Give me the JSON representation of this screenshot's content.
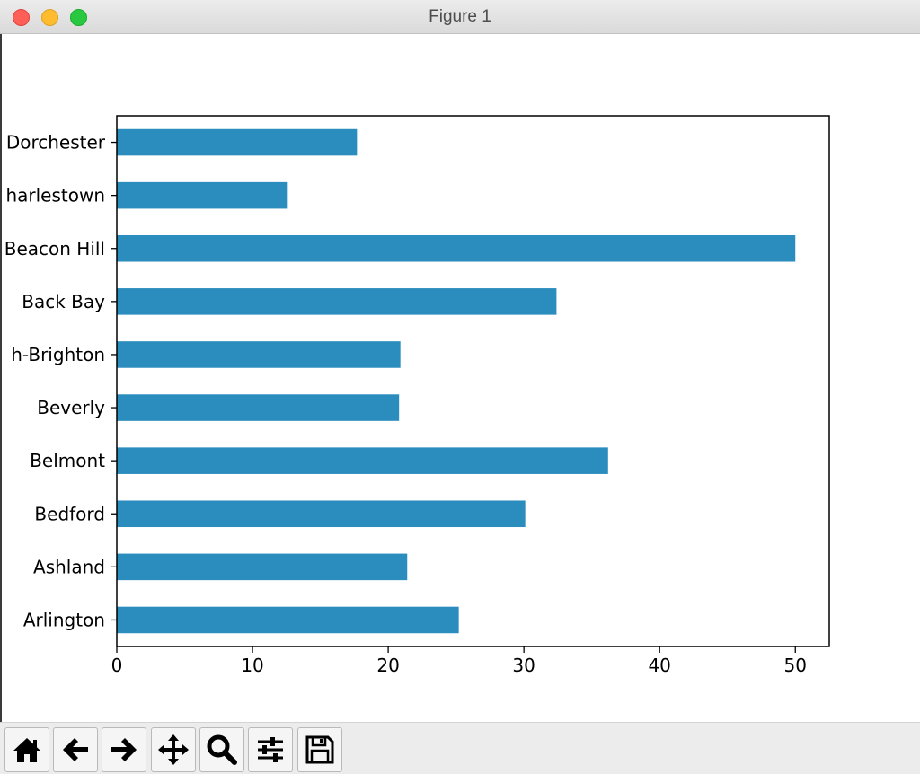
{
  "window": {
    "title": "Figure 1"
  },
  "toolbar": {
    "buttons": [
      {
        "name": "home-button",
        "icon": "home-icon"
      },
      {
        "name": "back-button",
        "icon": "arrow-left-icon"
      },
      {
        "name": "forward-button",
        "icon": "arrow-right-icon"
      },
      {
        "name": "pan-button",
        "icon": "move-icon"
      },
      {
        "name": "zoom-button",
        "icon": "magnifier-icon"
      },
      {
        "name": "configure-subplots-button",
        "icon": "sliders-icon"
      },
      {
        "name": "save-button",
        "icon": "floppy-disk-icon"
      }
    ]
  },
  "chart_data": {
    "type": "bar",
    "orientation": "horizontal",
    "categories": [
      "Arlington",
      "Ashland",
      "Bedford",
      "Belmont",
      "Beverly",
      "Brighton",
      "Back Bay",
      "Beacon Hill",
      "Charlestown",
      "Dorchester"
    ],
    "category_labels_visible": [
      "Arlington",
      "Ashland",
      "Bedford",
      "Belmont",
      "Beverly",
      "h-Brighton",
      "Back Bay",
      "Beacon Hill",
      "harlestown",
      "Dorchester"
    ],
    "values": [
      25.2,
      21.4,
      30.1,
      36.2,
      20.8,
      20.9,
      32.4,
      50.0,
      12.6,
      17.7
    ],
    "xticks": [
      0,
      10,
      20,
      30,
      40,
      50
    ],
    "xlim": [
      0,
      52.5
    ],
    "bar_color": "#2b8cbe",
    "grid": false,
    "title": "",
    "xlabel": "",
    "ylabel": ""
  }
}
